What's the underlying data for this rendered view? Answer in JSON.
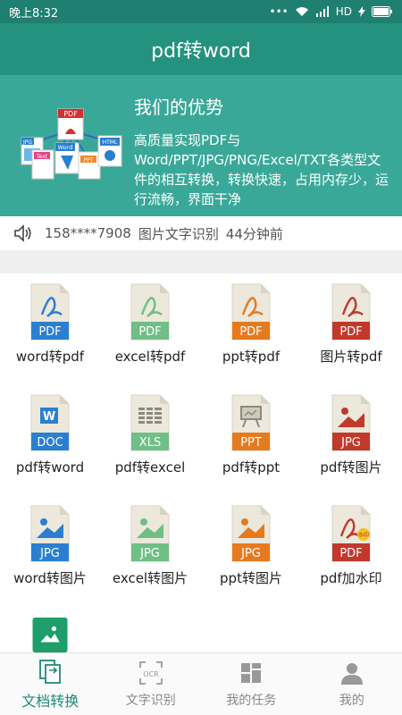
{
  "status": {
    "time": "晚上8:32",
    "network": "HD"
  },
  "header": {
    "title": "pdf转word"
  },
  "hero": {
    "title": "我们的优势",
    "description": "高质量实现PDF与Word/PPT/JPG/PNG/Excel/TXT各类型文件的相互转换，转换快速，占用内存少，运行流畅，界面干净",
    "illustration_labels": {
      "pdf": "PDF",
      "jpg": "JPG",
      "text": "Text",
      "word": "Word",
      "ppt": "PPT",
      "html": "HTML"
    }
  },
  "ticker": {
    "user": "158****7908",
    "action": "图片文字识别",
    "time": "44分钟前"
  },
  "tools": [
    {
      "badge": "PDF",
      "label": "word转pdf",
      "icon": "word-to-pdf-icon"
    },
    {
      "badge": "PDF",
      "label": "excel转pdf",
      "icon": "excel-to-pdf-icon"
    },
    {
      "badge": "PDF",
      "label": "ppt转pdf",
      "icon": "ppt-to-pdf-icon"
    },
    {
      "badge": "PDF",
      "label": "图片转pdf",
      "icon": "image-to-pdf-icon"
    },
    {
      "badge": "DOC",
      "label": "pdf转word",
      "icon": "pdf-to-word-icon"
    },
    {
      "badge": "XLS",
      "label": "pdf转excel",
      "icon": "pdf-to-excel-icon"
    },
    {
      "badge": "PPT",
      "label": "pdf转ppt",
      "icon": "pdf-to-ppt-icon"
    },
    {
      "badge": "JPG",
      "label": "pdf转图片",
      "icon": "pdf-to-image-icon"
    },
    {
      "badge": "JPG",
      "label": "word转图片",
      "icon": "word-to-image-icon"
    },
    {
      "badge": "JPG",
      "label": "excel转图片",
      "icon": "excel-to-image-icon"
    },
    {
      "badge": "JPG",
      "label": "ppt转图片",
      "icon": "ppt-to-image-icon"
    },
    {
      "badge": "PDF",
      "label": "pdf加水印",
      "icon": "pdf-watermark-icon",
      "stamp": "水印"
    }
  ],
  "nav": [
    {
      "label": "文档转换",
      "icon": "document-convert-icon",
      "active": true
    },
    {
      "label": "文字识别",
      "icon": "ocr-icon",
      "active": false,
      "icon_text": "OCR"
    },
    {
      "label": "我的任务",
      "icon": "tasks-grid-icon",
      "active": false
    },
    {
      "label": "我的",
      "icon": "user-profile-icon",
      "active": false
    }
  ],
  "colors": {
    "status_bar": "#1f7f70",
    "title_bar": "#24927f",
    "hero": "#3aa898",
    "blue": "#2a7fd0",
    "green": "#6fbf86",
    "orange": "#e57a1e",
    "red": "#c0392b",
    "gray": "#8a8a80",
    "nav_active": "#1f8a77"
  }
}
